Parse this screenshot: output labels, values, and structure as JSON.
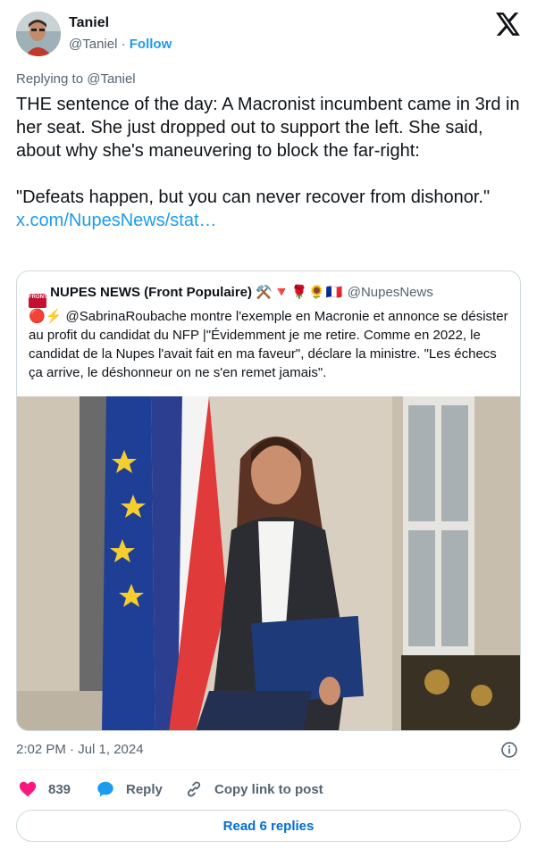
{
  "author": {
    "name": "Taniel",
    "handle": "@Taniel",
    "separator": "·",
    "follow_label": "Follow"
  },
  "replying_to": "Replying to @Taniel",
  "tweet": {
    "text": "THE sentence of the day: A Macronist incumbent came in 3rd in her seat. She just dropped out to support the left. She said, about why she's maneuvering to block the far-right:\n\n\"Defeats happen, but you can never recover from dishonor.\" ",
    "link": "x.com/NupesNews/stat…"
  },
  "quote": {
    "name": "NUPES NEWS (Front Populaire)",
    "emojis": "⚒️🔻🌹🌻🇫🇷",
    "handle": "@NupesNews",
    "logo_text": "FRONT POPUL.",
    "text": "🔴⚡ @SabrinaRoubache montre l'exemple en Macronie et annonce se désister au profit du candidat du NFP |\"Évidemment je me retire. Comme en 2022, le candidat de la Nupes l'avait fait en ma faveur\", déclare la ministre. \"Les échecs ça arrive, le déshonneur on ne s'en remet jamais\"."
  },
  "timestamp": "2:02 PM · Jul 1, 2024",
  "actions": {
    "like_count": "839",
    "reply_label": "Reply",
    "copy_label": "Copy link to post"
  },
  "read_replies_label": "Read 6 replies",
  "colors": {
    "accent": "#1d9bf0",
    "like": "#f91880",
    "secondary_text": "#536471",
    "border": "#cfd9de"
  },
  "icons": [
    "x-logo-icon",
    "info-icon",
    "heart-icon",
    "reply-bubble-icon",
    "link-icon"
  ]
}
